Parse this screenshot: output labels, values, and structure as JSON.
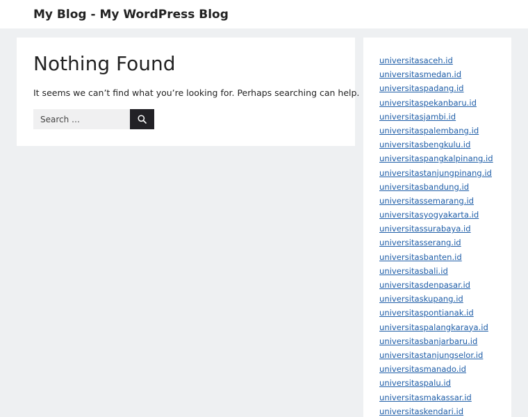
{
  "header": {
    "site_title": "My Blog - My WordPress Blog"
  },
  "main": {
    "title": "Nothing Found",
    "message": "It seems we can’t find what you’re looking for. Perhaps searching can help.",
    "search": {
      "placeholder": "Search …",
      "value": "",
      "button_icon": "search-icon"
    }
  },
  "sidebar": {
    "links": [
      {
        "label": "universitasaceh.id"
      },
      {
        "label": "universitasmedan.id"
      },
      {
        "label": "universitaspadang.id"
      },
      {
        "label": "universitaspekanbaru.id"
      },
      {
        "label": "universitasjambi.id"
      },
      {
        "label": "universitaspalembang.id"
      },
      {
        "label": "universitasbengkulu.id"
      },
      {
        "label": "universitaspangkalpinang.id"
      },
      {
        "label": "universitastanjungpinang.id"
      },
      {
        "label": "universitasbandung.id"
      },
      {
        "label": "universitassemarang.id"
      },
      {
        "label": "universitasyogyakarta.id"
      },
      {
        "label": "universitassurabaya.id"
      },
      {
        "label": "universitasserang.id"
      },
      {
        "label": "universitasbanten.id"
      },
      {
        "label": "universitasbali.id"
      },
      {
        "label": "universitasdenpasar.id"
      },
      {
        "label": "universitaskupang.id"
      },
      {
        "label": "universitaspontianak.id"
      },
      {
        "label": "universitaspalangkaraya.id"
      },
      {
        "label": "universitasbanjarbaru.id"
      },
      {
        "label": "universitastanjungselor.id"
      },
      {
        "label": "universitasmanado.id"
      },
      {
        "label": "universitaspalu.id"
      },
      {
        "label": "universitasmakassar.id"
      },
      {
        "label": "universitaskendari.id"
      }
    ]
  },
  "colors": {
    "page_background": "#eef0f2",
    "surface": "#ffffff",
    "text": "#222222",
    "link": "#1f5ea8",
    "search_button": "#222126",
    "search_field": "#f0f0f1"
  }
}
